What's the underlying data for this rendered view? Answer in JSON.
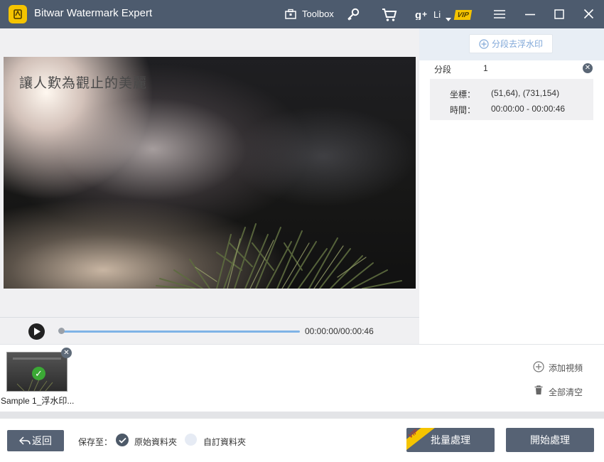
{
  "app": {
    "title": "Bitwar Watermark Expert"
  },
  "titlebar": {
    "toolbox_label": "Toolbox",
    "user_name": "Li",
    "vip_badge": "VIP",
    "icons": [
      "toolbox-icon",
      "key-icon",
      "cart-icon",
      "google-plus-icon",
      "dropdown-caret-icon",
      "menu-icon",
      "minimize-icon",
      "maximize-icon",
      "close-icon"
    ]
  },
  "video": {
    "watermark_text": "讓人歎為觀止的美麗"
  },
  "player": {
    "time": "00:00:00/00:00:46",
    "progress": 0
  },
  "segments": {
    "add_button": "分段去浮水印",
    "label": "分段",
    "index": "1",
    "coords_key": "坐標：",
    "coords_value": "(51,64), (731,154)",
    "time_key": "時間：",
    "time_value": "00:00:00 - 00:00:46"
  },
  "files": {
    "items": [
      {
        "name": "Sample 1_浮水印..."
      }
    ],
    "add_video": "添加視頻",
    "clear_all": "全部清空"
  },
  "footer": {
    "back": "返回",
    "save_to": "保存至：",
    "option_original": "原始資料夾",
    "option_custom": "自訂資料夾",
    "batch": "批量處理",
    "batch_badge": "VIP",
    "start": "開始處理"
  },
  "colors": {
    "titlebar": "#4d5b6e",
    "button": "#566274",
    "accent": "#7fa7d8",
    "check": "#3ba935",
    "logo": "#f5c400"
  }
}
